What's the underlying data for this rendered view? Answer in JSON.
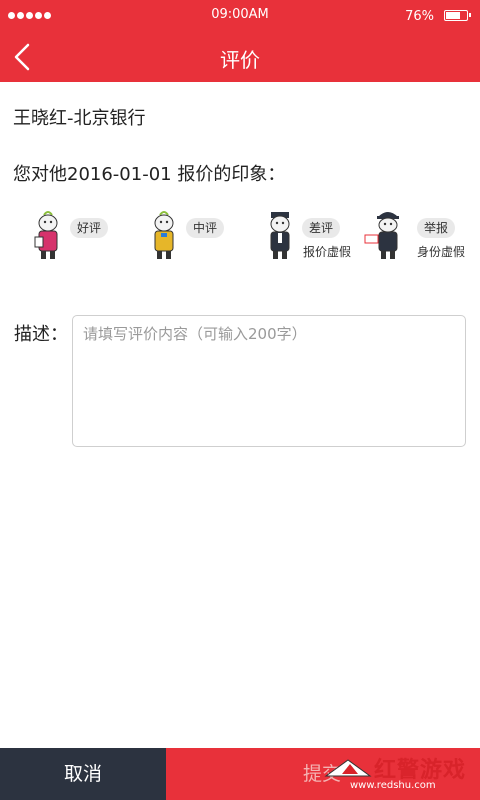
{
  "status_bar": {
    "time": "09:00AM",
    "battery": "76%",
    "battery_level": 0.76
  },
  "header": {
    "title": "评价"
  },
  "bank_line": "王晓红-北京银行",
  "question": "您对他2016-01-01 报价的印象：",
  "ratings": [
    {
      "label": "好评",
      "sub": ""
    },
    {
      "label": "中评",
      "sub": ""
    },
    {
      "label": "差评",
      "sub": "报价虚假"
    },
    {
      "label": "举报",
      "sub": "身份虚假"
    }
  ],
  "description": {
    "label": "描述：",
    "placeholder": "请填写评价内容（可输入200字）",
    "value": ""
  },
  "footer": {
    "cancel_label": "取消",
    "submit_label": "提交"
  },
  "watermark": {
    "brand": "红警游戏",
    "url": "www.redshu.com"
  },
  "colors": {
    "primary_red": "#e8313a",
    "dark_button": "#2c3340"
  }
}
